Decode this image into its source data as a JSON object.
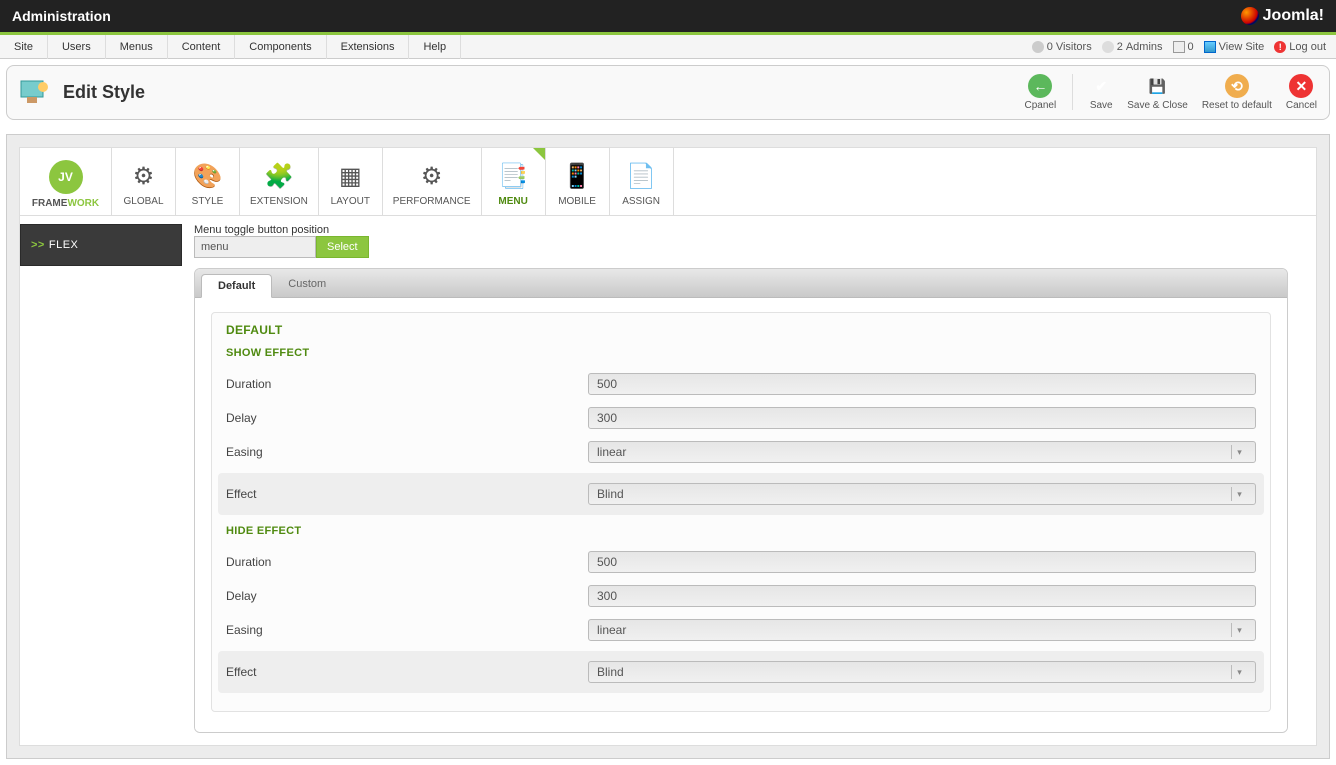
{
  "topbar": {
    "title": "Administration",
    "brand": "Joomla!"
  },
  "menubar": {
    "items": [
      "Site",
      "Users",
      "Menus",
      "Content",
      "Components",
      "Extensions",
      "Help"
    ],
    "status": {
      "visitors_count": "0",
      "visitors_label": "Visitors",
      "admins_count": "2",
      "admins_label": "Admins",
      "messages_count": "0",
      "viewsite": "View Site",
      "logout": "Log out"
    }
  },
  "page": {
    "title": "Edit Style"
  },
  "actions": {
    "cpanel": "Cpanel",
    "save": "Save",
    "saveclose": "Save & Close",
    "reset": "Reset to default",
    "cancel": "Cancel"
  },
  "framework_tabs": {
    "framework_prefix": "FRAME",
    "framework_suffix": "WORK",
    "framework_badge": "JV",
    "items": [
      {
        "label": "GLOBAL",
        "glyph": "⚙"
      },
      {
        "label": "STYLE",
        "glyph": "🎨"
      },
      {
        "label": "EXTENSION",
        "glyph": "🧩"
      },
      {
        "label": "LAYOUT",
        "glyph": "▦"
      },
      {
        "label": "PERFORMANCE",
        "glyph": "⚙"
      },
      {
        "label": "MENU",
        "glyph": "📑"
      },
      {
        "label": "MOBILE",
        "glyph": "📱"
      },
      {
        "label": "ASSIGN",
        "glyph": "📄"
      }
    ],
    "active": 5
  },
  "sidebar": {
    "flex": "FLEX",
    "arrows": ">>"
  },
  "toggle": {
    "label": "Menu toggle button position",
    "value": "menu",
    "select": "Select"
  },
  "panel_tabs": {
    "default": "Default",
    "custom": "Custom"
  },
  "form": {
    "default_heading": "DEFAULT",
    "show_heading": "SHOW EFFECT",
    "hide_heading": "HIDE EFFECT",
    "labels": {
      "duration": "Duration",
      "delay": "Delay",
      "easing": "Easing",
      "effect": "Effect"
    },
    "show": {
      "duration": "500",
      "delay": "300",
      "easing": "linear",
      "effect": "Blind"
    },
    "hide": {
      "duration": "500",
      "delay": "300",
      "easing": "linear",
      "effect": "Blind"
    }
  }
}
